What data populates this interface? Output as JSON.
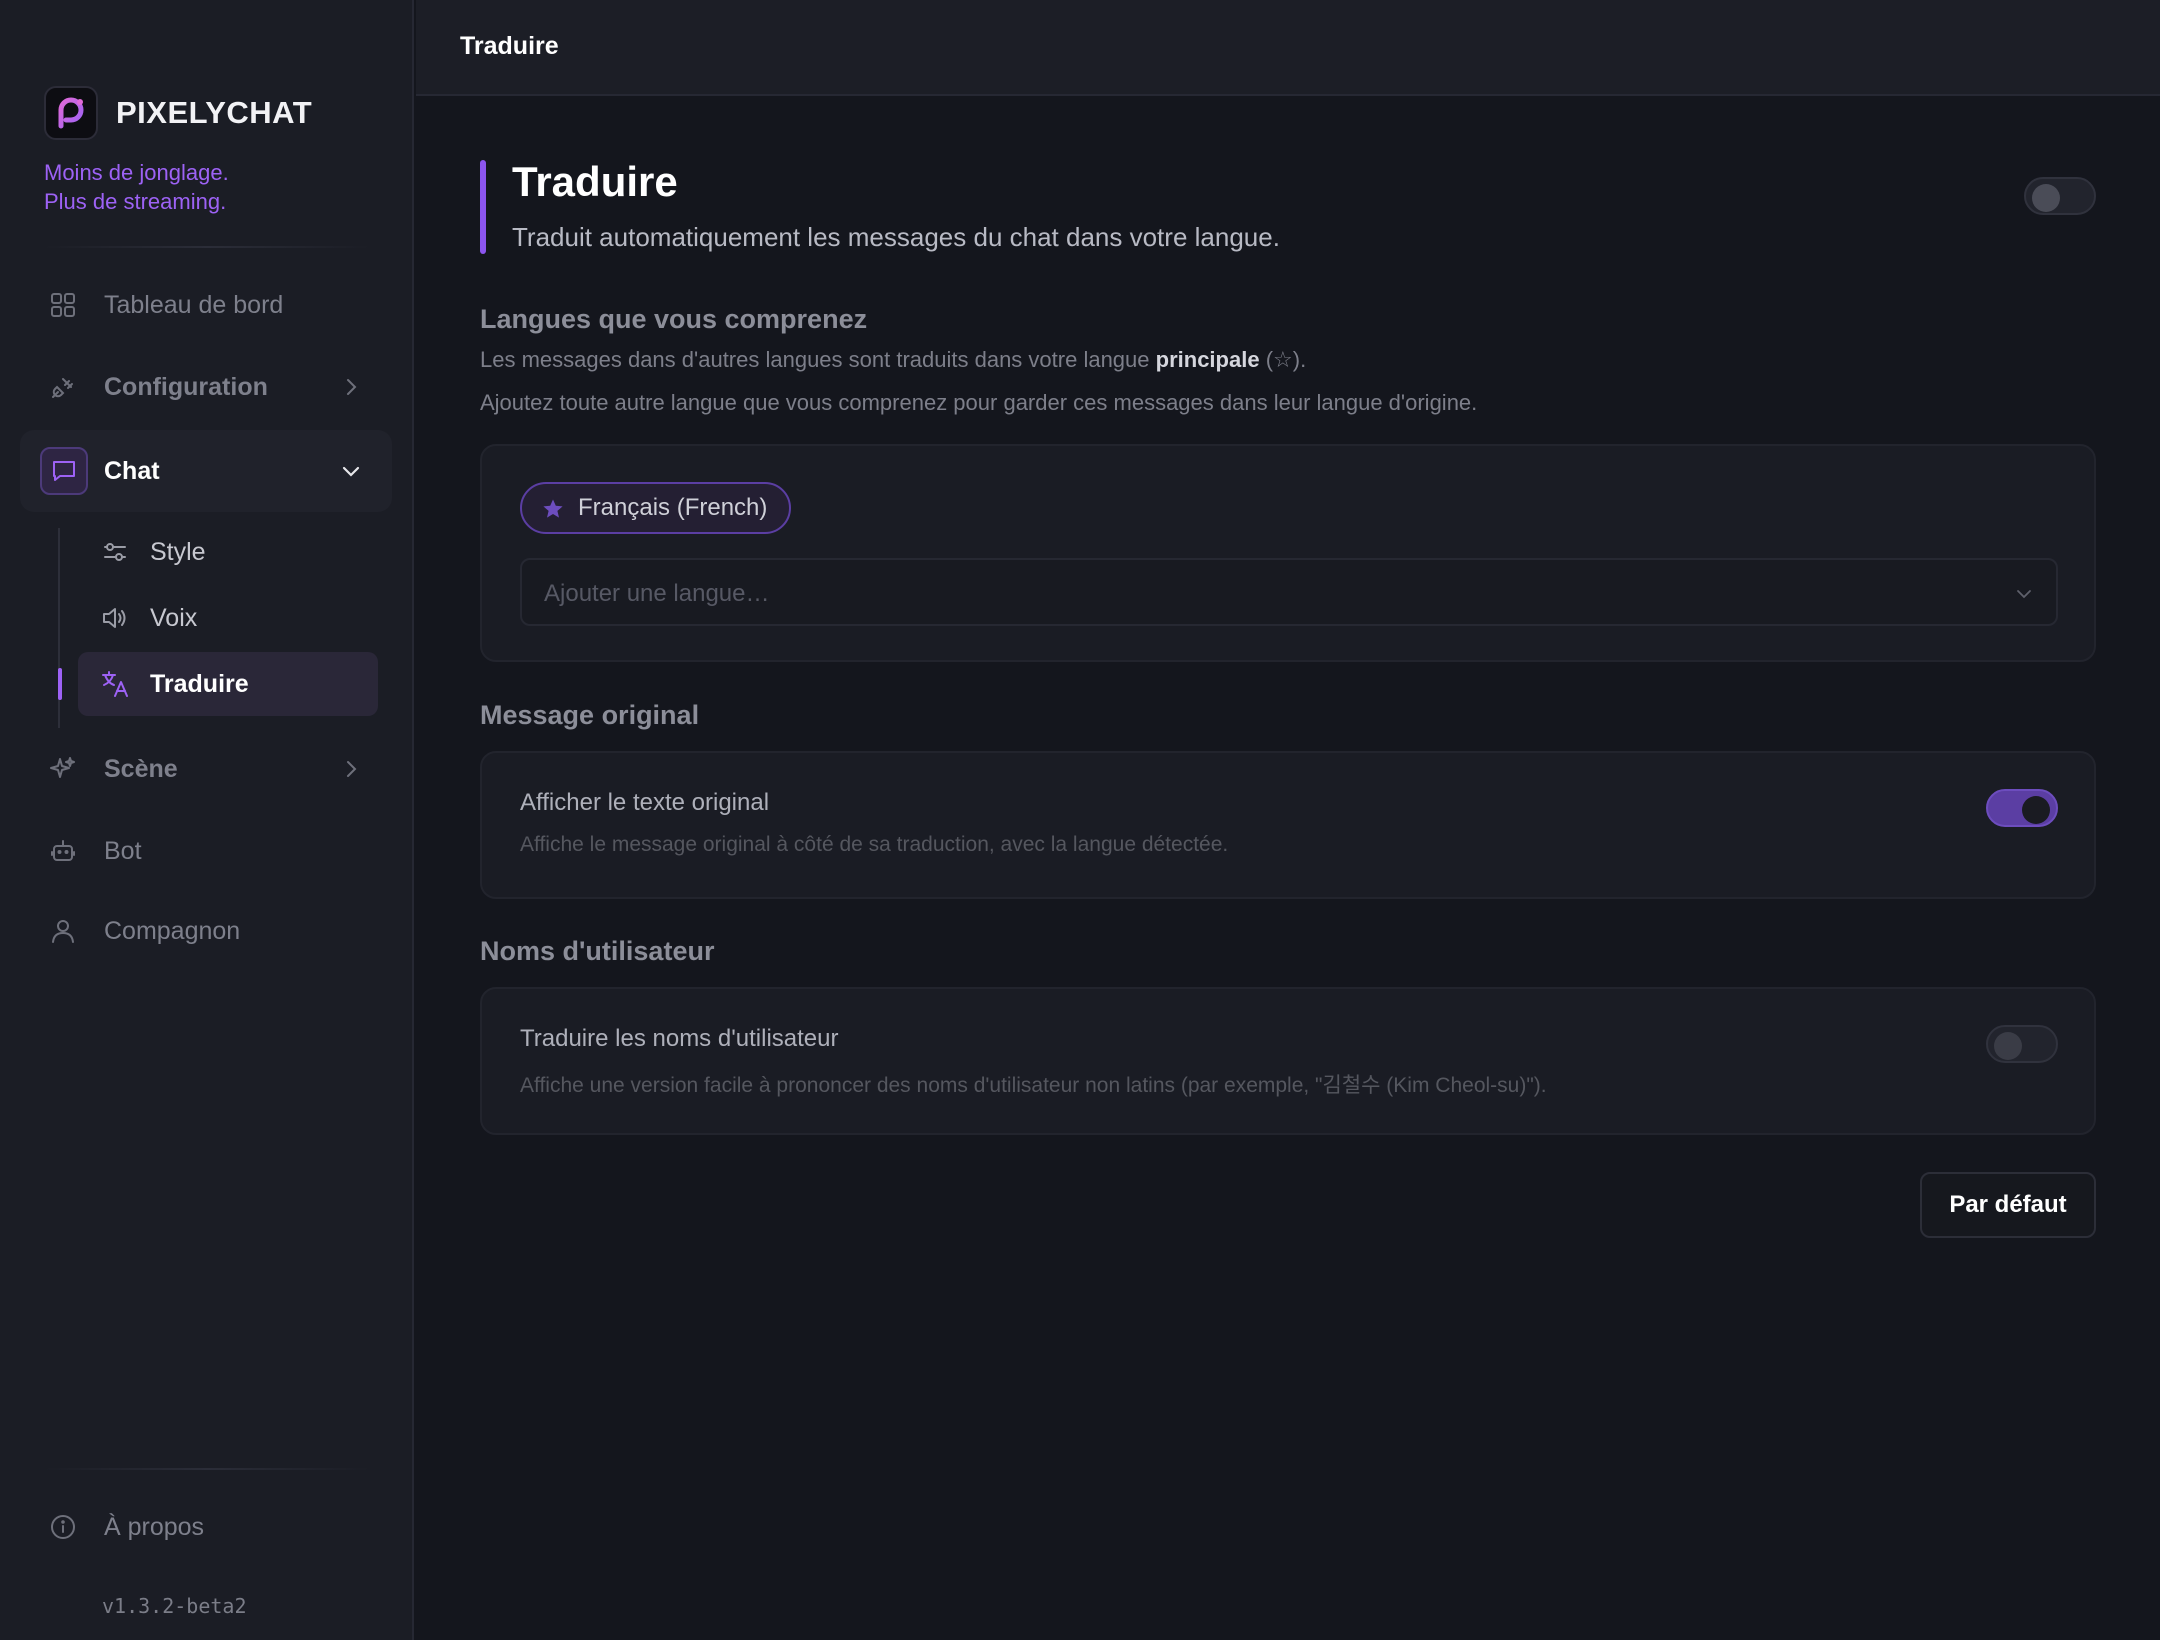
{
  "brand": {
    "name": "PIXELYCHAT",
    "tagline_line1": "Moins de jonglage.",
    "tagline_line2": "Plus de streaming."
  },
  "sidebar": {
    "items": [
      {
        "label": "Tableau de bord",
        "icon": "dashboard-grid-icon"
      },
      {
        "label": "Configuration",
        "icon": "plug-icon"
      },
      {
        "label": "Chat",
        "icon": "chat-bubble-icon",
        "expanded": true
      },
      {
        "label": "Scène",
        "icon": "sparkles-icon"
      },
      {
        "label": "Bot",
        "icon": "robot-icon"
      },
      {
        "label": "Compagnon",
        "icon": "user-icon"
      }
    ],
    "chat_subitems": [
      {
        "label": "Style",
        "icon": "sliders-icon"
      },
      {
        "label": "Voix",
        "icon": "speaker-icon"
      },
      {
        "label": "Traduire",
        "icon": "translate-icon",
        "active": true
      }
    ],
    "about_label": "À propos",
    "version": "v1.3.2-beta2"
  },
  "header": {
    "title": "Traduire"
  },
  "page": {
    "title": "Traduire",
    "subtitle": "Traduit automatiquement les messages du chat dans votre langue.",
    "enabled": false
  },
  "languages": {
    "title": "Langues que vous comprenez",
    "desc_prefix": "Les messages dans d'autres langues sont traduits dans votre langue",
    "desc_bold": "principale",
    "desc_suffix": "(☆).",
    "desc_line2": "Ajoutez toute autre langue que vous comprenez pour garder ces messages dans leur langue d'origine.",
    "primary_language": "Français (French)",
    "add_placeholder": "Ajouter une langue…"
  },
  "original_message": {
    "section_title": "Message original",
    "row_title": "Afficher le texte original",
    "row_desc": "Affiche le message original à côté de sa traduction, avec la langue détectée.",
    "enabled": true
  },
  "usernames": {
    "section_title": "Noms d'utilisateur",
    "row_title": "Traduire les noms d'utilisateur",
    "row_desc": "Affiche une version facile à prononcer des noms d'utilisateur non latins (par exemple, \"김철수 (Kim Cheol-su)\").",
    "enabled": false
  },
  "actions": {
    "default_label": "Par défaut"
  },
  "colors": {
    "accent": "#9d62f5",
    "background": "#14161d",
    "sidebar": "#1b1d25"
  }
}
